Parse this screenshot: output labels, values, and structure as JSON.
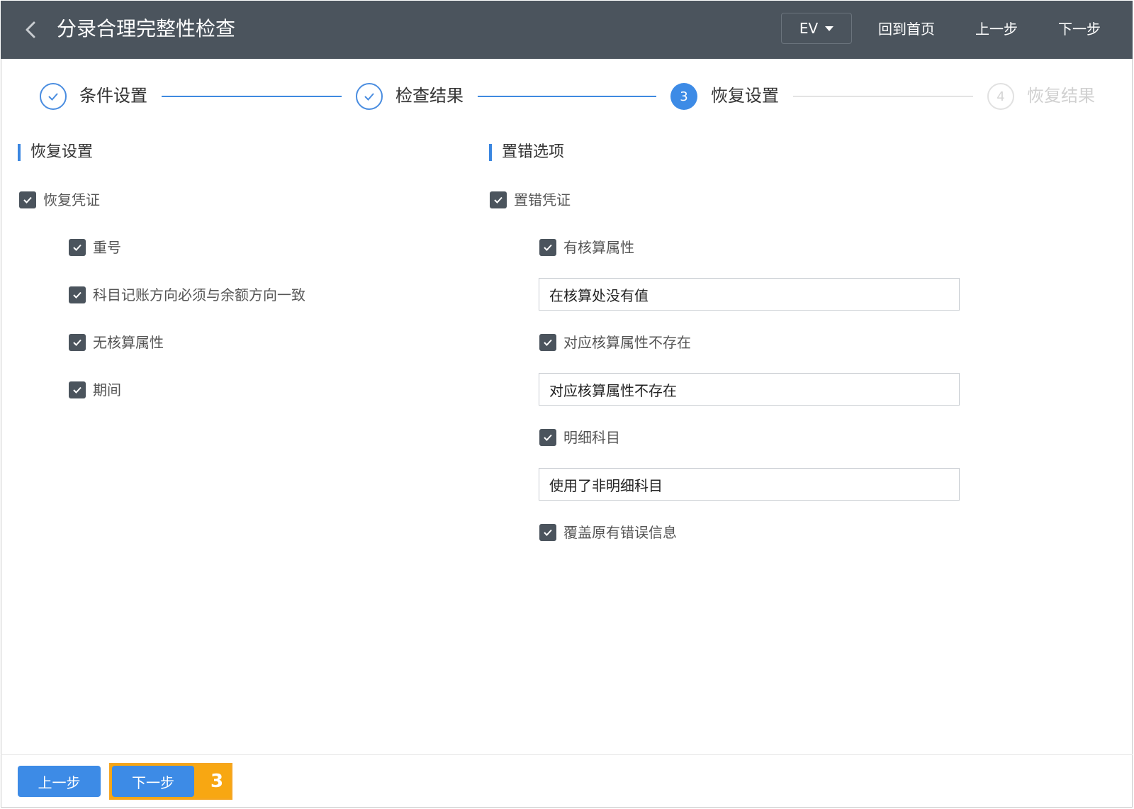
{
  "header": {
    "title": "分录合理完整性检查",
    "lang": "EV",
    "home": "回到首页",
    "prev": "上一步",
    "next": "下一步"
  },
  "steps": [
    {
      "num": "",
      "label": "条件设置",
      "state": "done"
    },
    {
      "num": "",
      "label": "检查结果",
      "state": "done"
    },
    {
      "num": "3",
      "label": "恢复设置",
      "state": "active"
    },
    {
      "num": "4",
      "label": "恢复结果",
      "state": "todo"
    }
  ],
  "restore": {
    "title": "恢复设置",
    "main": {
      "label": "恢复凭证",
      "checked": true
    },
    "options": [
      {
        "label": "重号",
        "checked": true
      },
      {
        "label": "科目记账方向必须与余额方向一致",
        "checked": true
      },
      {
        "label": "无核算属性",
        "checked": true
      },
      {
        "label": "期间",
        "checked": true
      }
    ]
  },
  "error": {
    "title": "置错选项",
    "main": {
      "label": "置错凭证",
      "checked": true
    },
    "options": [
      {
        "label": "有核算属性",
        "checked": true,
        "input": "在核算处没有值"
      },
      {
        "label": "对应核算属性不存在",
        "checked": true,
        "input": "对应核算属性不存在"
      },
      {
        "label": "明细科目",
        "checked": true,
        "input": "使用了非明细科目"
      },
      {
        "label": "覆盖原有错误信息",
        "checked": true
      }
    ]
  },
  "footer": {
    "prev": "上一步",
    "next": "下一步",
    "badge": "3"
  },
  "colors": {
    "header_bg": "#4b545d",
    "accent": "#3d8be6",
    "highlight": "#f8a712"
  }
}
